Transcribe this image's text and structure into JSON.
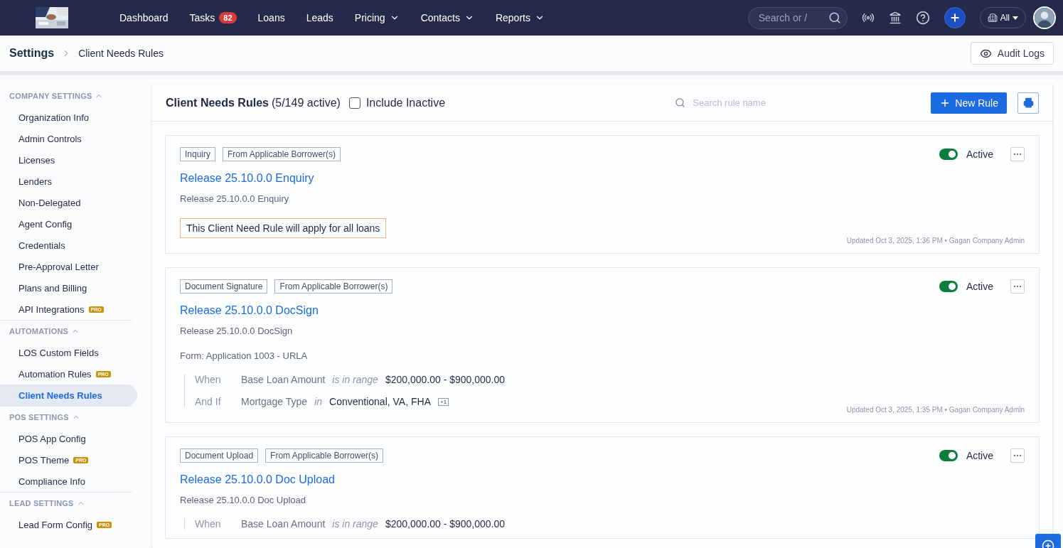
{
  "topbar": {
    "nav": [
      {
        "label": "Dashboard",
        "dropdown": false
      },
      {
        "label": "Tasks",
        "badge": "82",
        "dropdown": false
      },
      {
        "label": "Loans",
        "dropdown": false
      },
      {
        "label": "Leads",
        "dropdown": false
      },
      {
        "label": "Pricing",
        "dropdown": true
      },
      {
        "label": "Contacts",
        "dropdown": true
      },
      {
        "label": "Reports",
        "dropdown": true
      }
    ],
    "search": {
      "placeholder": "Search or /"
    },
    "scope": {
      "value": "All"
    }
  },
  "breadcrumb": {
    "root": "Settings",
    "current": "Client Needs Rules"
  },
  "audit_button": {
    "label": "Audit Logs"
  },
  "sidebar": {
    "sections": [
      {
        "title": "COMPANY SETTINGS",
        "expanded": true,
        "items": [
          {
            "label": "Organization Info",
            "selected": false
          },
          {
            "label": "Admin Controls",
            "selected": false
          },
          {
            "label": "Licenses",
            "selected": false
          },
          {
            "label": "Lenders",
            "selected": false
          },
          {
            "label": "Non-Delegated",
            "selected": false
          },
          {
            "label": "Agent Config",
            "selected": false
          },
          {
            "label": "Credentials",
            "selected": false
          },
          {
            "label": "Pre-Approval Letter",
            "selected": false
          },
          {
            "label": "Plans and Billing",
            "selected": false
          },
          {
            "label": "API Integrations",
            "badge": "PRO",
            "selected": false
          }
        ]
      },
      {
        "title": "AUTOMATIONS",
        "expanded": true,
        "items": [
          {
            "label": "LOS Custom Fields",
            "selected": false
          },
          {
            "label": "Automation Rules",
            "badge": "PRO",
            "selected": false
          },
          {
            "label": "Client Needs Rules",
            "selected": true
          }
        ]
      },
      {
        "title": "POS SETTINGS",
        "expanded": true,
        "items": [
          {
            "label": "POS App Config",
            "selected": false
          },
          {
            "label": "POS Theme",
            "badge": "PRO",
            "selected": false
          },
          {
            "label": "Compliance Info",
            "selected": false
          }
        ]
      },
      {
        "title": "LEAD SETTINGS",
        "expanded": true,
        "items": [
          {
            "label": "Lead Form Config",
            "badge": "PRO",
            "selected": false
          }
        ]
      }
    ]
  },
  "header": {
    "title": "Client Needs Rules",
    "count": "(5/149 active)",
    "include_inactive": {
      "label": "Include Inactive",
      "checked": false
    },
    "search": {
      "placeholder": "Search rule name"
    },
    "new_button": "New Rule"
  },
  "rules": [
    {
      "tags": [
        "Inquiry",
        "From Applicable Borrower(s)"
      ],
      "active": true,
      "status": "Active",
      "title": "Release 25.10.0.0 Enquiry",
      "description": "Release 25.10.0.0 Enquiry",
      "kind": "all-loans",
      "note": "This Client Need Rule will apply for all loans",
      "updated": "Updated Oct 3, 2025, 1:36 PM • Gagan Company Admin"
    },
    {
      "tags": [
        "Document Signature",
        "From Applicable Borrower(s)"
      ],
      "active": true,
      "status": "Active",
      "title": "Release 25.10.0.0 DocSign",
      "description": "Release 25.10.0.0 DocSign",
      "kind": "conditions",
      "form": "Form: Application 1003 - URLA",
      "conditions": [
        {
          "connector": "When",
          "field": "Base Loan Amount",
          "operator": "is in range",
          "value": "$200,000.00 - $900,000.00"
        },
        {
          "connector": "And If",
          "field": "Mortgage Type",
          "operator": "in",
          "value": "Conventional, VA, FHA",
          "extra": "+1"
        }
      ],
      "updated": "Updated Oct 3, 2025, 1:35 PM • Gagan Company Admin"
    },
    {
      "tags": [
        "Document Upload",
        "From Applicable Borrower(s)"
      ],
      "active": true,
      "status": "Active",
      "title": "Release 25.10.0.0 Doc Upload",
      "description": "Release 25.10.0.0 Doc Upload",
      "kind": "conditions",
      "conditions": [
        {
          "connector": "When",
          "field": "Base Loan Amount",
          "operator": "is in range",
          "value": "$200,000.00 - $900,000.00"
        }
      ]
    }
  ]
}
